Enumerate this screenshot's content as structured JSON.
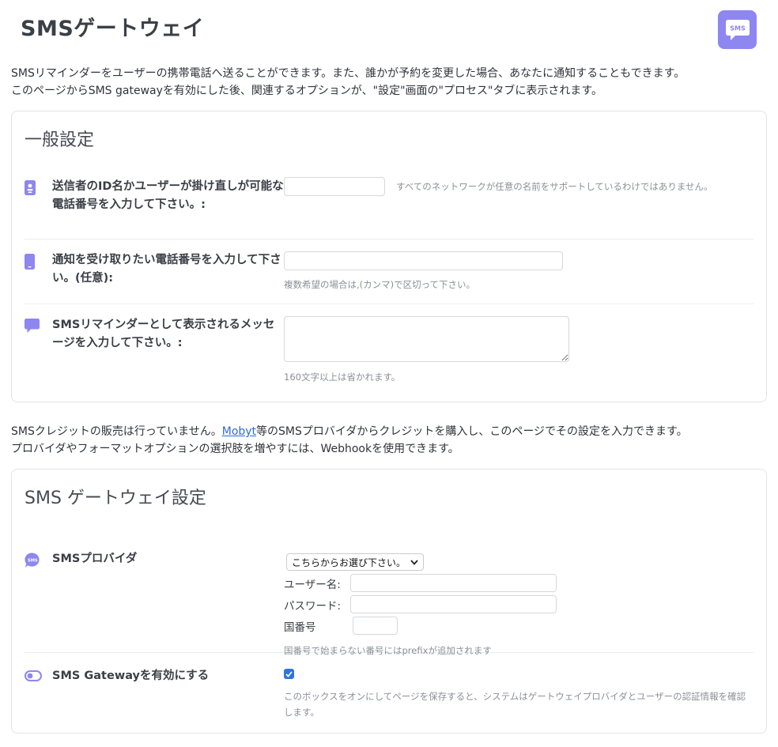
{
  "page": {
    "title": "SMSゲートウェイ",
    "logo_text": "SMS",
    "intro_line1": "SMSリマインダーをユーザーの携帯電話へ送ることができます。また、誰かが予約を変更した場合、あなたに通知することもできます。",
    "intro_line2": "このページからSMS gatewayを有効にした後、関連するオプションが、\"設定\"画面の\"プロセス\"タブに表示されます。"
  },
  "general": {
    "title": "一般設定",
    "sender": {
      "label": "送信者のID名かユーザーが掛け直しが可能な電話番号を入力して下さい。:",
      "value": "",
      "hint": "すべてのネットワークが任意の名前をサポートしているわけではありません。"
    },
    "notify": {
      "label": "通知を受け取りたい電話番号を入力して下さい。(任意):",
      "value": "",
      "hint": "複数希望の場合は,(カンマ)で区切って下さい。"
    },
    "message": {
      "label": "SMSリマインダーとして表示されるメッセージを入力して下さい。:",
      "value": "",
      "hint": "160文字以上は省かれます。"
    }
  },
  "middle": {
    "line1_before": "SMSクレジットの販売は行っていません。",
    "link": "Mobyt",
    "line1_after": "等のSMSプロバイダからクレジットを購入し、このページでその設定を入力できます。",
    "line2": "プロバイダやフォーマットオプションの選択肢を増やすには、Webhookを使用できます。"
  },
  "gateway": {
    "title": "SMS ゲートウェイ設定",
    "provider": {
      "label": "SMSプロバイダ",
      "icon_text": "SMS",
      "select_value": "こちらからお選び下さい。",
      "username_label": "ユーザー名:",
      "username_value": "",
      "password_label": "パスワード:",
      "password_value": "",
      "country_label": "国番号",
      "country_value": "",
      "hint": "国番号で始まらない番号にはprefixが追加されます"
    },
    "enable": {
      "label": "SMS Gatewayを有効にする",
      "checked": true,
      "hint": "このボックスをオンにしてページを保存すると、システムはゲートウェイプロバイダとユーザーの認証情報を確認します。"
    }
  },
  "colors": {
    "accent": "#8e86f1",
    "checkbox": "#2f74e0",
    "link": "#2f6ad9"
  }
}
